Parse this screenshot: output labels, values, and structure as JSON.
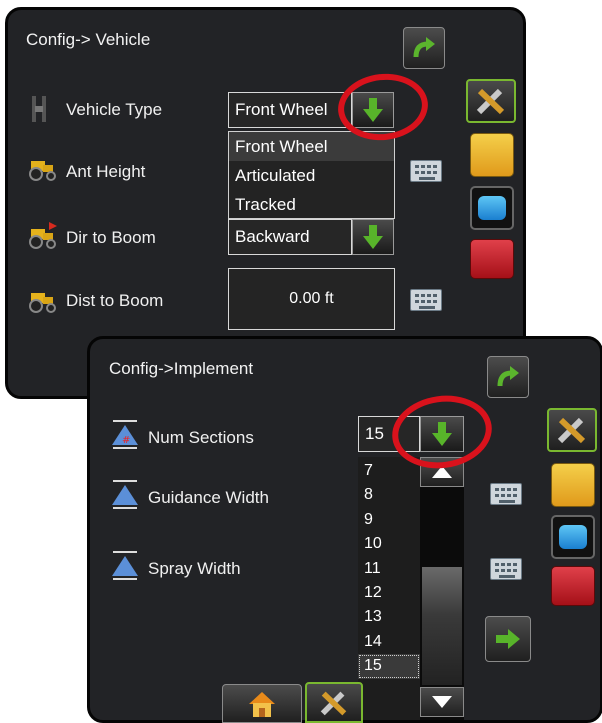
{
  "vehicle_panel": {
    "title": "Config-> Vehicle",
    "rows": [
      {
        "label": "Vehicle Type"
      },
      {
        "label": "Ant Height"
      },
      {
        "label": "Dir to Boom"
      },
      {
        "label": "Dist to Boom"
      }
    ],
    "vehicle_type_value": "Front Wheel",
    "vehicle_type_options": [
      "Front Wheel",
      "Articulated",
      "Tracked"
    ],
    "dir_to_boom_value": "Backward",
    "dist_to_boom_value": "0.00 ft"
  },
  "implement_panel": {
    "title": "Config->Implement",
    "rows": [
      {
        "label": "Num Sections"
      },
      {
        "label": "Guidance Width"
      },
      {
        "label": "Spray Width"
      }
    ],
    "num_sections_value": "15",
    "num_sections_options": [
      "7",
      "8",
      "9",
      "10",
      "11",
      "12",
      "13",
      "14",
      "15"
    ],
    "selected_option": "15"
  },
  "colors": {
    "panel_bg": "#222326",
    "accent_green": "#4caf2a",
    "highlight_red": "#d9121c"
  },
  "icons": {
    "back": "curved-arrow-icon",
    "dropdown": "green-down-arrow-icon",
    "keyboard": "keyboard-icon",
    "tools": "wrench-screwdriver-icon",
    "toolbox_yellow": "yellow-toolbox-icon",
    "screen": "blue-display-icon",
    "toolbox_red": "red-toolbox-icon",
    "home": "home-icon",
    "next": "green-right-arrow-icon"
  }
}
